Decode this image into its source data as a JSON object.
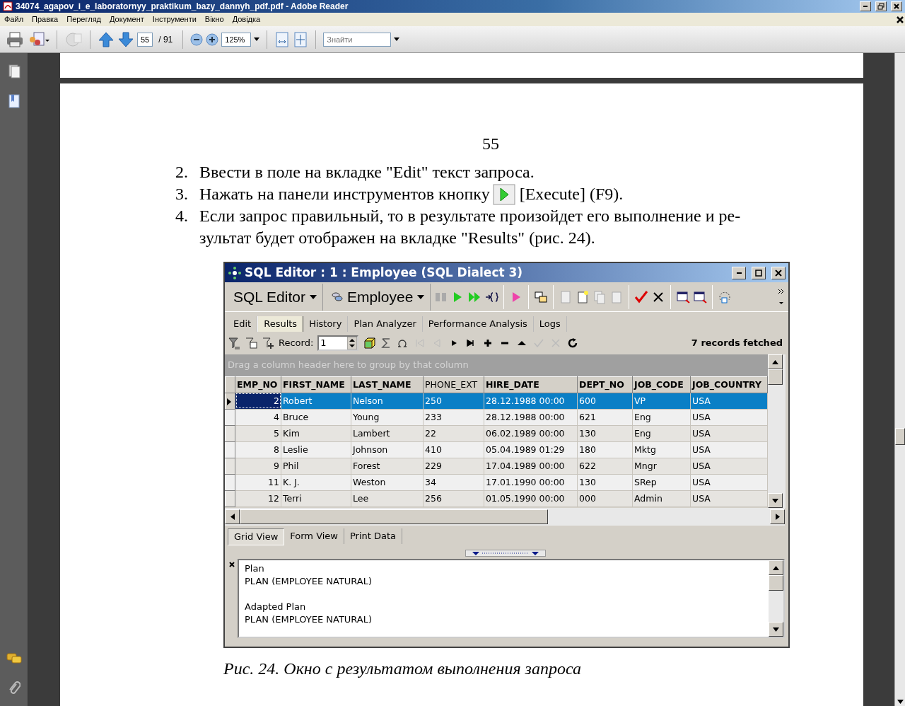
{
  "window": {
    "title": "34074_agapov_i_e_laboratornyy_praktikum_bazy_dannyh_pdf.pdf - Adobe Reader"
  },
  "menu": [
    "Файл",
    "Правка",
    "Перегляд",
    "Документ",
    "Інструменти",
    "Вікно",
    "Довідка"
  ],
  "toolbar": {
    "page": "55",
    "page_total": "/ 91",
    "zoom": "125%",
    "search": {
      "placeholder": "Знайти"
    }
  },
  "document": {
    "page_number": "55",
    "steps": [
      {
        "number": "2.",
        "lines": [
          "Ввести в поле на вкладке \"Edit\" текст запроса."
        ]
      },
      {
        "number": "3.",
        "lines": [
          "Нажать на панели инструментов кнопку"
        ],
        "suffix": "[Execute] (F9)."
      },
      {
        "number": "4.",
        "lines": [
          "Если запрос правильный, то в результате произойдет его выполнение и ре-",
          "зультат будет отображен на вкладке \"Results\" (рис. 24)."
        ]
      }
    ],
    "figure": {
      "title": "SQL Editor : 1 : Employee (SQL Dialect 3)",
      "menus": [
        "SQL Editor",
        "Employee"
      ],
      "tabs": [
        {
          "label": "Edit",
          "selected": false
        },
        {
          "label": "Results",
          "selected": true
        },
        {
          "label": "History",
          "selected": false
        },
        {
          "label": "Plan Analyzer",
          "selected": false
        },
        {
          "label": "Performance Analysis",
          "selected": false
        },
        {
          "label": "Logs",
          "selected": false
        }
      ],
      "record_label": "Record:",
      "record": "1",
      "status": "7 records fetched",
      "group_hint": "Drag a column header here to group by that column",
      "columns": [
        "EMP_NO",
        "FIRST_NAME",
        "LAST_NAME",
        "PHONE_EXT",
        "HIRE_DATE",
        "DEPT_NO",
        "JOB_CODE",
        "JOB_COUNTRY"
      ],
      "rows": [
        {
          "selected": true,
          "cells": [
            "2",
            "Robert",
            "Nelson",
            "250",
            "28.12.1988 00:00",
            "600",
            "VP",
            "USA"
          ]
        },
        {
          "selected": false,
          "cells": [
            "4",
            "Bruce",
            "Young",
            "233",
            "28.12.1988 00:00",
            "621",
            "Eng",
            "USA"
          ]
        },
        {
          "selected": false,
          "cells": [
            "5",
            "Kim",
            "Lambert",
            "22",
            "06.02.1989 00:00",
            "130",
            "Eng",
            "USA"
          ]
        },
        {
          "selected": false,
          "cells": [
            "8",
            "Leslie",
            "Johnson",
            "410",
            "05.04.1989 01:29",
            "180",
            "Mktg",
            "USA"
          ]
        },
        {
          "selected": false,
          "cells": [
            "9",
            "Phil",
            "Forest",
            "229",
            "17.04.1989 00:00",
            "622",
            "Mngr",
            "USA"
          ]
        },
        {
          "selected": false,
          "cells": [
            "11",
            "K. J.",
            "Weston",
            "34",
            "17.01.1990 00:00",
            "130",
            "SRep",
            "USA"
          ]
        },
        {
          "selected": false,
          "cells": [
            "12",
            "Terri",
            "Lee",
            "256",
            "01.05.1990 00:00",
            "000",
            "Admin",
            "USA"
          ]
        }
      ],
      "views": [
        {
          "label": "Grid View",
          "selected": true
        },
        {
          "label": "Form View",
          "selected": false
        },
        {
          "label": "Print Data",
          "selected": false
        }
      ],
      "plan": [
        {
          "title": "Plan",
          "text": "PLAN (EMPLOYEE NATURAL)"
        },
        {
          "title": "Adapted Plan",
          "text": "PLAN (EMPLOYEE NATURAL)"
        }
      ]
    },
    "caption": "Рис. 24. Окно с результатом выполнения запроса"
  }
}
